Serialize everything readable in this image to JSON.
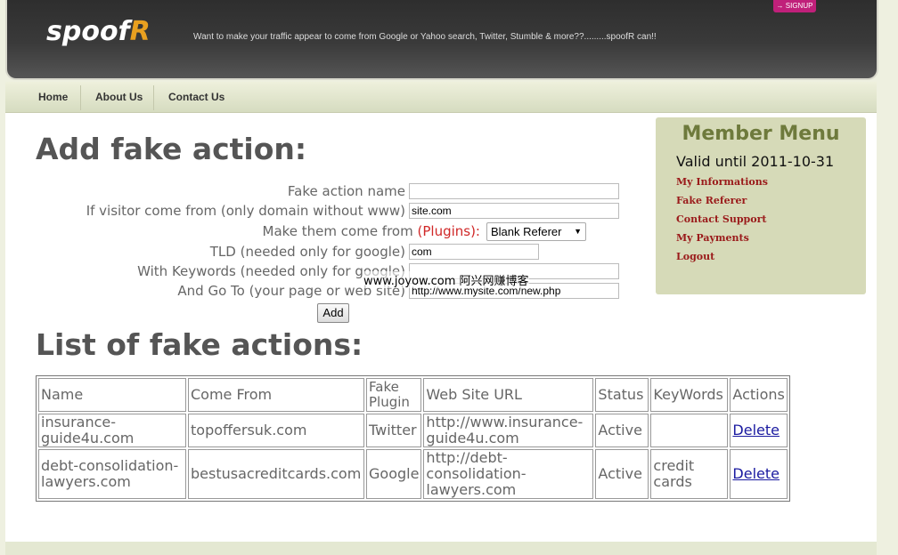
{
  "header": {
    "logo_main": "spoof",
    "logo_accent": "R",
    "tagline": "Want to make your traffic appear to come from Google or Yahoo search, Twitter, Stumble & more??.........spoofR can!!",
    "signup_label": "→ SIGNUP"
  },
  "nav": {
    "items": [
      {
        "label": "Home"
      },
      {
        "label": "About Us"
      },
      {
        "label": "Contact Us"
      }
    ]
  },
  "form": {
    "title": "Add fake action:",
    "fields": {
      "name_label": "Fake action name",
      "name_value": "",
      "from_label": "If visitor come from (only domain without www)",
      "from_value": "site.com",
      "make_label": "Make them come from",
      "plugins_label": "(Plugins):",
      "plugin_value": "Blank Referer",
      "tld_label": "TLD (needed only for google)",
      "tld_value": "com",
      "keywords_label": "With Keywords (needed only for google)",
      "keywords_value": "",
      "goto_label": "And Go To (your page or web site)",
      "goto_value": "http://www.mysite.com/new.php"
    },
    "add_button": "Add",
    "watermark": "www.joyow.com 阿兴网赚博客"
  },
  "list": {
    "title": "List of fake actions:",
    "headers": [
      "Name",
      "Come From",
      "Fake Plugin",
      "Web Site URL",
      "Status",
      "KeyWords",
      "Actions"
    ],
    "rows": [
      {
        "name": "insurance-guide4u.com",
        "from": "topoffersuk.com",
        "plugin": "Twitter",
        "url": "http://www.insurance-guide4u.com",
        "status": "Active",
        "keywords": "",
        "action": "Delete"
      },
      {
        "name": "debt-consolidation-lawyers.com",
        "from": "bestusacreditcards.com",
        "plugin": "Google",
        "url": "http://debt-consolidation-lawyers.com",
        "status": "Active",
        "keywords": "credit cards",
        "action": "Delete"
      }
    ]
  },
  "member_menu": {
    "title": "Member Menu",
    "valid_until": "Valid until 2011-10-31",
    "links": [
      {
        "label": "My Informations"
      },
      {
        "label": "Fake Referer"
      },
      {
        "label": "Contact Support"
      },
      {
        "label": "My Payments"
      },
      {
        "label": "Logout"
      }
    ]
  }
}
